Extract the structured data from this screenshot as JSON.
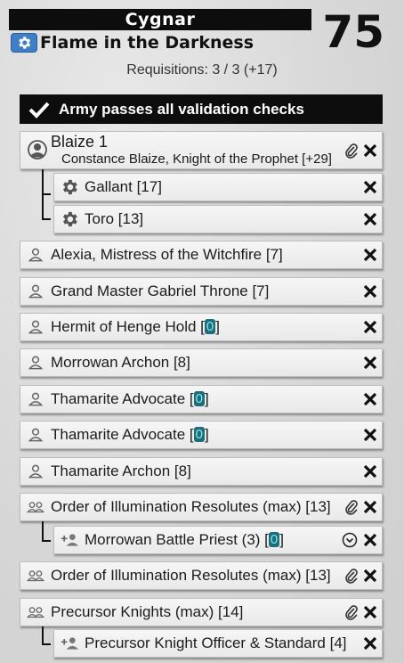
{
  "header": {
    "faction": "Cygnar",
    "list_name": "Flame in the Darkness",
    "score": "75",
    "requisitions": "Requisitions: 3 / 3 (+17)"
  },
  "validation": {
    "message": "Army passes all validation checks"
  },
  "colors": {
    "accent": "#3f7fc6",
    "bar": "#0d0d0d",
    "free_badge": "#1b6e7a",
    "free_text": "#7fe9f2"
  },
  "caster": {
    "title": "Blaize 1",
    "subtitle": "Constance Blaize, Knight of the Prophet [+29]",
    "icon": "solo-circle-icon",
    "children": [
      {
        "label": "Gallant [17]",
        "icon": "gear-icon"
      },
      {
        "label": "Toro [13]",
        "icon": "gear-icon"
      }
    ]
  },
  "entries": [
    {
      "prefix": "Alexia, Mistress of the Witchfire [7]",
      "free": "",
      "suffix": "",
      "icon": "person-icon"
    },
    {
      "prefix": "Grand Master Gabriel Throne [7]",
      "free": "",
      "suffix": "",
      "icon": "person-icon"
    },
    {
      "prefix": "Hermit of Henge Hold [",
      "free": "0",
      "suffix": "]",
      "icon": "person-icon"
    },
    {
      "prefix": "Morrowan Archon [8]",
      "free": "",
      "suffix": "",
      "icon": "person-icon"
    },
    {
      "prefix": "Thamarite Advocate [",
      "free": "0",
      "suffix": "]",
      "icon": "person-icon"
    },
    {
      "prefix": "Thamarite Advocate [",
      "free": "0",
      "suffix": "]",
      "icon": "person-icon"
    },
    {
      "prefix": "Thamarite Archon [8]",
      "free": "",
      "suffix": "",
      "icon": "person-icon"
    }
  ],
  "units": [
    {
      "label": "Order of Illumination Resolutes (max) [13]",
      "icon": "group-icon",
      "attachment": {
        "prefix": "Morrowan Battle Priest (3) [",
        "free": "0",
        "suffix": "]",
        "icon": "add-person-icon",
        "has_chevron": true
      }
    },
    {
      "label": "Order of Illumination Resolutes (max) [13]",
      "icon": "group-icon",
      "attachment": null
    },
    {
      "label": "Precursor Knights (max) [14]",
      "icon": "group-icon",
      "attachment": {
        "prefix": "Precursor Knight Officer & Standard [4]",
        "free": "",
        "suffix": "",
        "icon": "add-person-icon",
        "has_chevron": false
      }
    }
  ]
}
